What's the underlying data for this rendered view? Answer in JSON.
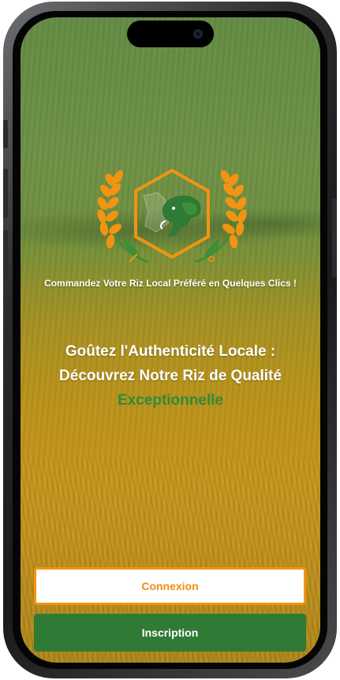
{
  "tagline": "Commandez Votre Riz Local Préféré en Quelques Clics !",
  "headline": {
    "line1": "Goûtez l'Authenticité Locale :",
    "line2": "Découvrez Notre Riz de Qualité",
    "accent": "Exceptionnelle"
  },
  "buttons": {
    "login_label": "Connexion",
    "signup_label": "Inscription"
  },
  "colors": {
    "accent_green": "#2f7a34",
    "accent_orange": "#f29411",
    "text_white": "#ffffff"
  },
  "icons": {
    "logo": "elephant-rice-hexagon-logo"
  }
}
